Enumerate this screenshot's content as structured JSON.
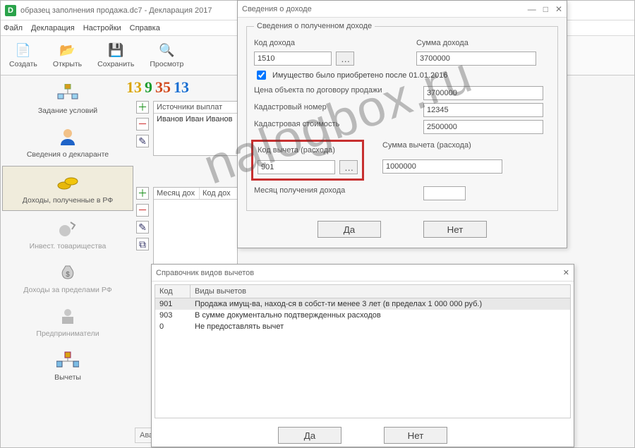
{
  "main": {
    "title": "образец заполнения продажа.dc7 - Декларация 2017",
    "icon_letter": "D"
  },
  "menubar": [
    "Файл",
    "Декларация",
    "Настройки",
    "Справка"
  ],
  "toolbar": {
    "create": "Создать",
    "open": "Открыть",
    "save": "Сохранить",
    "view": "Просмотр"
  },
  "sidebar": {
    "items": [
      {
        "label": "Задание условий"
      },
      {
        "label": "Сведения о декларанте"
      },
      {
        "label": "Доходы, полученные в РФ"
      },
      {
        "label": "Инвест. товарищества"
      },
      {
        "label": "Доходы за пределами РФ"
      },
      {
        "label": "Предприниматели"
      },
      {
        "label": "Вычеты"
      }
    ],
    "active_index": 2
  },
  "lottery": [
    "13",
    "9",
    "35",
    "13"
  ],
  "lottery_colors": [
    "#d9a409",
    "#1d9c2f",
    "#d14a1e",
    "#1b6fd1"
  ],
  "sources": {
    "header": "Источники выплат",
    "row": "Иванов Иван Иванов"
  },
  "month_table": {
    "col1": "Месяц дох",
    "col2": "Код дох"
  },
  "bottom_label": "Аванс",
  "dialog_income": {
    "title": "Сведения о доходе",
    "group_caption": "Сведения о полученном доходе",
    "label_code": "Код дохода",
    "label_sum": "Сумма дохода",
    "code_value": "1510",
    "sum_value": "3700000",
    "checkbox_label": "Имущество было приобретено после 01.01.2016",
    "label_price": "Цена объекта по договору продажи",
    "price_value": "3700000",
    "label_cadnum": "Кадастровый номер",
    "cadnum_value": "12345",
    "label_cadcost": "Кадастровая стоимость",
    "cadcost_value": "2500000",
    "label_ded_code": "Код вычета (расхода)",
    "label_ded_sum": "Сумма вычета (расхода)",
    "ded_code_value": "901",
    "ded_sum_value": "1000000",
    "label_month": "Месяц получения дохода",
    "month_value": "",
    "btn_yes": "Да",
    "btn_no": "Нет"
  },
  "dialog_dict": {
    "title": "Справочник видов вычетов",
    "col_code": "Код",
    "col_name": "Виды вычетов",
    "rows": [
      {
        "code": "901",
        "name": "Продажа имущ-ва, наход-ся в собст-ти менее 3 лет (в пределах 1 000 000 руб.)"
      },
      {
        "code": "903",
        "name": "В сумме документально подтвержденных расходов"
      },
      {
        "code": "0",
        "name": "Не предоставлять вычет"
      }
    ],
    "selected_index": 0,
    "btn_yes": "Да",
    "btn_no": "Нет"
  },
  "watermark": "nalogbox.ru"
}
